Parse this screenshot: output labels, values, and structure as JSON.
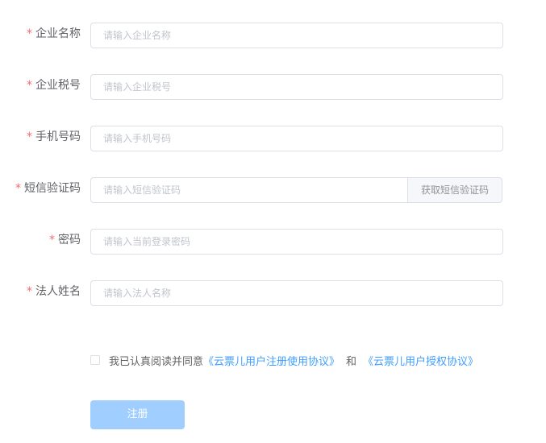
{
  "form": {
    "company_name": {
      "label": "企业名称",
      "required_mark": "*",
      "placeholder": "请输入企业名称",
      "value": ""
    },
    "tax_id": {
      "label": "企业税号",
      "required_mark": "*",
      "placeholder": "请输入企业税号",
      "value": ""
    },
    "phone": {
      "label": "手机号码",
      "required_mark": "*",
      "placeholder": "请输入手机号码",
      "value": ""
    },
    "sms_code": {
      "label": "短信验证码",
      "required_mark": "*",
      "placeholder": "请输入短信验证码",
      "value": "",
      "get_code_label": "获取短信验证码"
    },
    "password": {
      "label": "密码",
      "required_mark": "*",
      "placeholder": "请输入当前登录密码",
      "value": ""
    },
    "legal_name": {
      "label": "法人姓名",
      "required_mark": "*",
      "placeholder": "请输入法人名称",
      "value": ""
    }
  },
  "agreement": {
    "checked": false,
    "text": "我已认真阅读并同意",
    "link1": "《云票儿用户注册使用协议》",
    "and": "和",
    "link2": "《云票儿用户授权协议》"
  },
  "submit": {
    "label": "注册"
  },
  "colors": {
    "required": "#f56c6c",
    "link": "#409eff",
    "button_disabled": "#a0cfff",
    "border": "#dcdfe6",
    "placeholder": "#c0c4cc"
  }
}
